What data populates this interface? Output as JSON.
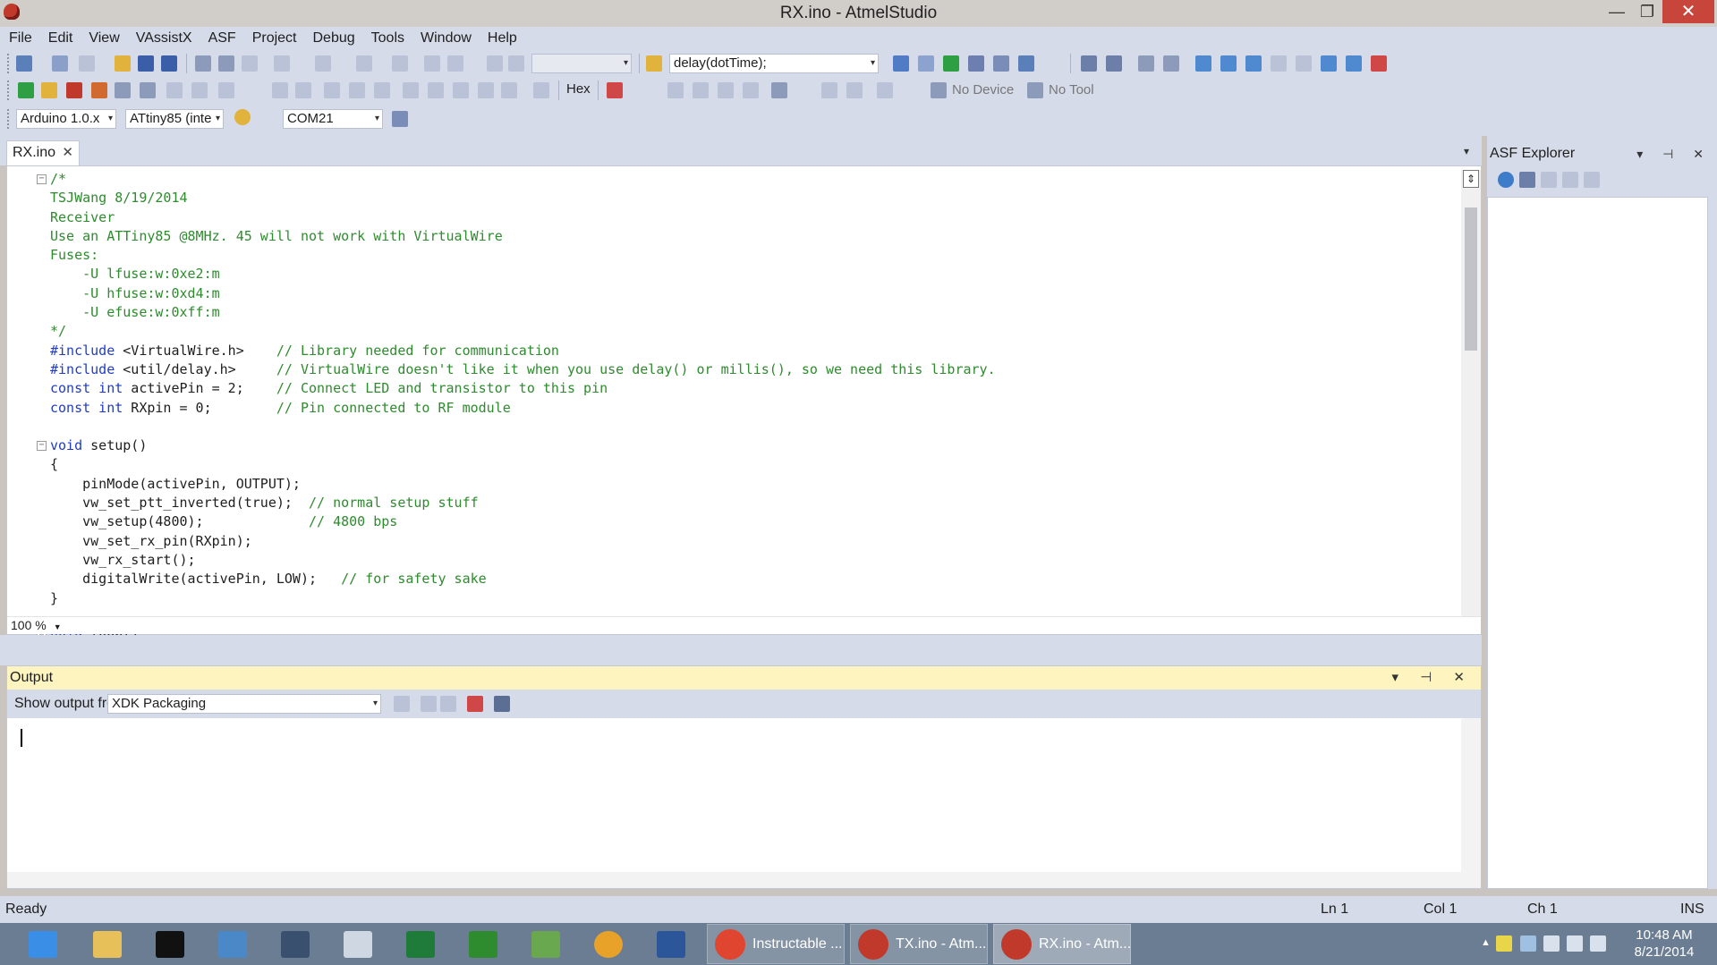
{
  "window": {
    "title": "RX.ino - AtmelStudio",
    "controls": {
      "minimize": "—",
      "maximize": "❐",
      "close": "✕"
    }
  },
  "menu": [
    "File",
    "Edit",
    "View",
    "VAssistX",
    "ASF",
    "Project",
    "Debug",
    "Tools",
    "Window",
    "Help"
  ],
  "toolbar": {
    "find_combo_value": "delay(dotTime);",
    "hex_label": "Hex",
    "no_device": "No Device",
    "no_tool": "No Tool",
    "board_select": "Arduino 1.0.x",
    "mcu_select": "ATtiny85 (inte",
    "port_select": "COM21"
  },
  "editor": {
    "tab_label": "RX.ino",
    "zoom": "100 %",
    "lines": [
      {
        "fold": "minus",
        "segments": [
          {
            "t": "comment",
            "v": "/*"
          }
        ]
      },
      {
        "segments": [
          {
            "t": "comment",
            "v": "TSJWang 8/19/2014"
          }
        ]
      },
      {
        "segments": [
          {
            "t": "comment",
            "v": "Receiver"
          }
        ]
      },
      {
        "segments": [
          {
            "t": "comment",
            "v": "Use an ATTiny85 @8MHz. 45 will not work with VirtualWire"
          }
        ]
      },
      {
        "segments": [
          {
            "t": "comment",
            "v": "Fuses:"
          }
        ]
      },
      {
        "segments": [
          {
            "t": "comment",
            "v": "    -U lfuse:w:0xe2:m"
          }
        ]
      },
      {
        "segments": [
          {
            "t": "comment",
            "v": "    -U hfuse:w:0xd4:m"
          }
        ]
      },
      {
        "segments": [
          {
            "t": "comment",
            "v": "    -U efuse:w:0xff:m"
          }
        ]
      },
      {
        "segments": [
          {
            "t": "comment",
            "v": "*/"
          }
        ]
      },
      {
        "segments": [
          {
            "t": "include",
            "v": "#include"
          },
          {
            "t": "text",
            "v": " <VirtualWire.h>    "
          },
          {
            "t": "comment",
            "v": "// Library needed for communication"
          }
        ]
      },
      {
        "segments": [
          {
            "t": "include",
            "v": "#include"
          },
          {
            "t": "text",
            "v": " <util/delay.h>     "
          },
          {
            "t": "comment",
            "v": "// VirtualWire doesn't like it when you use delay() or millis(), so we need this library."
          }
        ]
      },
      {
        "segments": [
          {
            "t": "keyword",
            "v": "const int"
          },
          {
            "t": "text",
            "v": " activePin = 2;    "
          },
          {
            "t": "comment",
            "v": "// Connect LED and transistor to this pin"
          }
        ]
      },
      {
        "segments": [
          {
            "t": "keyword",
            "v": "const int"
          },
          {
            "t": "text",
            "v": " RXpin = 0;        "
          },
          {
            "t": "comment",
            "v": "// Pin connected to RF module"
          }
        ]
      },
      {
        "segments": [
          {
            "t": "text",
            "v": ""
          }
        ]
      },
      {
        "fold": "minus",
        "segments": [
          {
            "t": "keyword",
            "v": "void"
          },
          {
            "t": "text",
            "v": " setup()"
          }
        ]
      },
      {
        "segments": [
          {
            "t": "text",
            "v": "{"
          }
        ]
      },
      {
        "segments": [
          {
            "t": "text",
            "v": "    pinMode(activePin, OUTPUT);"
          }
        ]
      },
      {
        "segments": [
          {
            "t": "text",
            "v": "    vw_set_ptt_inverted(true);  "
          },
          {
            "t": "comment",
            "v": "// normal setup stuff"
          }
        ]
      },
      {
        "segments": [
          {
            "t": "text",
            "v": "    vw_setup(4800);             "
          },
          {
            "t": "comment",
            "v": "// 4800 bps"
          }
        ]
      },
      {
        "segments": [
          {
            "t": "text",
            "v": "    vw_set_rx_pin(RXpin);"
          }
        ]
      },
      {
        "segments": [
          {
            "t": "text",
            "v": "    vw_rx_start();"
          }
        ]
      },
      {
        "segments": [
          {
            "t": "text",
            "v": "    digitalWrite(activePin, LOW);   "
          },
          {
            "t": "comment",
            "v": "// for safety sake"
          }
        ]
      },
      {
        "segments": [
          {
            "t": "text",
            "v": "}"
          }
        ]
      },
      {
        "segments": [
          {
            "t": "text",
            "v": ""
          }
        ]
      },
      {
        "fold": "minus",
        "segments": [
          {
            "t": "keyword",
            "v": "void"
          },
          {
            "t": "text",
            "v": " loop()"
          }
        ]
      }
    ]
  },
  "output": {
    "title": "Output",
    "show_from_label": "Show output from:",
    "source": "XDK Packaging",
    "header_buttons": "▾ ⊣ ✕"
  },
  "asf": {
    "title": "ASF Explorer",
    "header_buttons": "▾ ⊣ ✕"
  },
  "status": {
    "state": "Ready",
    "ln": "Ln 1",
    "col": "Col 1",
    "ch": "Ch 1",
    "mode": "INS"
  },
  "taskbar": {
    "windows": [
      {
        "label": "Instructable ...",
        "icon_color": "#e0452f"
      },
      {
        "label": "TX.ino - Atm...",
        "icon_color": "#c0392b"
      },
      {
        "label": "RX.ino - Atm...",
        "icon_color": "#c0392b",
        "active": true
      }
    ],
    "clock_time": "10:48 AM",
    "clock_date": "8/21/2014"
  },
  "colors": {
    "chrome": "#d6dbe9",
    "comment": "#2e8b2e",
    "keyword": "#1f3bc6",
    "output_header": "#fdf4bf",
    "taskbar": "#6b7d92"
  }
}
